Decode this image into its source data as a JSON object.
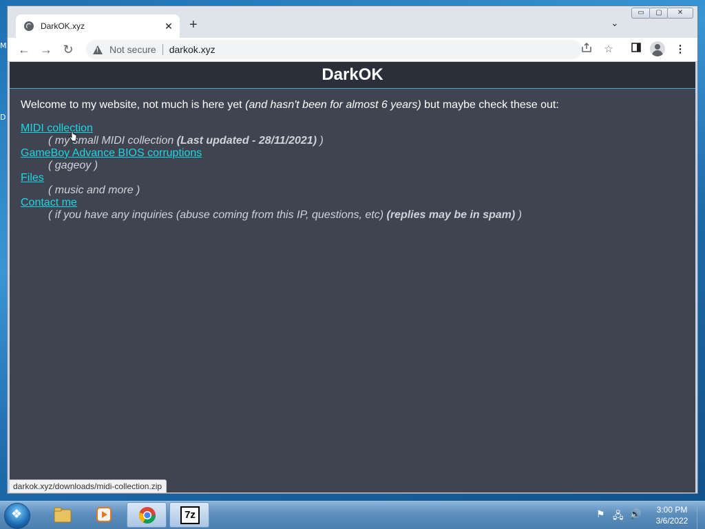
{
  "desktop": {
    "fragments": [
      "M",
      "D"
    ]
  },
  "browser": {
    "tab": {
      "title": "DarkOK.xyz",
      "close": "✕"
    },
    "new_tab": "+",
    "tab_search": "⌄",
    "window_controls": {
      "minimize": "▭",
      "maximize": "▢",
      "close": "✕"
    },
    "nav": {
      "back": "←",
      "forward": "→",
      "reload": "↻"
    },
    "omnibox": {
      "security_label": "Not secure",
      "url": "darkok.xyz"
    },
    "toolbar_icons": [
      "share-icon",
      "star-icon",
      "side-panel-icon",
      "profile-icon",
      "menu-icon"
    ],
    "status_url": "darkok.xyz/downloads/midi-collection.zip"
  },
  "site": {
    "title": "DarkOK",
    "welcome_prefix": "Welcome to my website, not much is here yet ",
    "welcome_italic": "(and hasn't been for almost 6 years)",
    "welcome_suffix": " but maybe check these out:",
    "items": [
      {
        "link": "MIDI collection",
        "desc": "( my small MIDI collection ",
        "desc_bold": "(Last updated - 28/11/2021)",
        "desc_end": " )"
      },
      {
        "link": "GameBoy Advance BIOS corruptions",
        "desc": "( gageoy )",
        "desc_bold": "",
        "desc_end": ""
      },
      {
        "link": "Files",
        "desc": "( music and more )",
        "desc_bold": "",
        "desc_end": ""
      },
      {
        "link": "Contact me",
        "desc": "( if you have any inquiries (abuse coming from this IP, questions, etc) ",
        "desc_bold": "(replies may be in spam)",
        "desc_end": " )"
      }
    ]
  },
  "taskbar": {
    "apps": [
      "windows-explorer-icon",
      "media-player-icon",
      "chrome-icon",
      "7zip-icon"
    ],
    "seven_zip_label": "7z",
    "time": "3:00 PM",
    "date": "3/6/2022"
  },
  "colors": {
    "page_bg": "#3f4450",
    "header_bg": "#2a2f3a",
    "link": "#19d7e6"
  }
}
